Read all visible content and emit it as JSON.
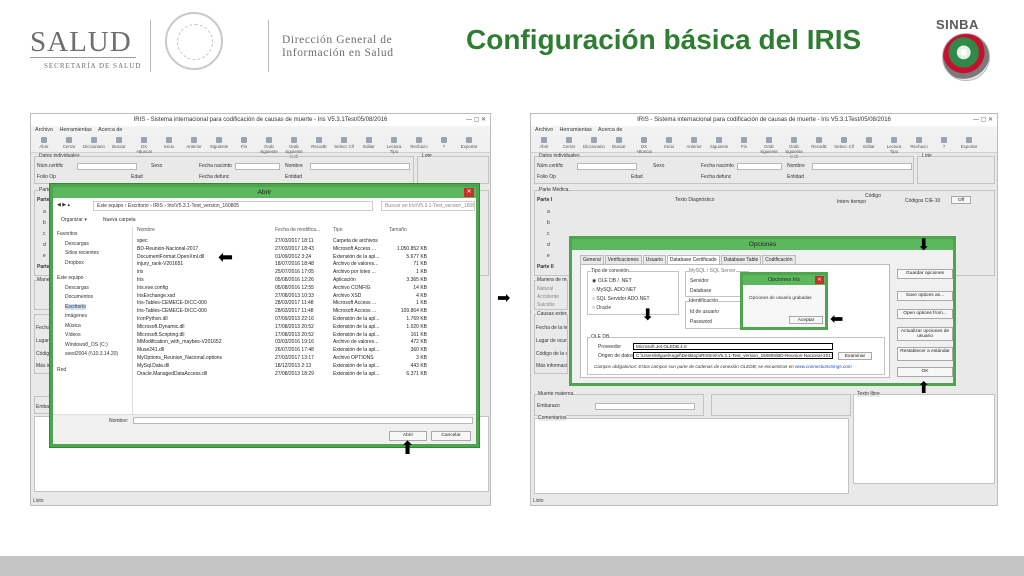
{
  "header": {
    "salud": "SALUD",
    "salud_sub": "SECRETARÍA DE SALUD",
    "dgis_line1": "Dirección General de",
    "dgis_line2": "Información en Salud",
    "title": "Configuración básica del IRIS",
    "sinba": "SINBA"
  },
  "iris": {
    "title": "IRIS - Sistema internacional para codificación de causas de muerte - Iris V5.3.1Test/05/08/2016",
    "menu": [
      "Archivo",
      "Herramientas",
      "Acerca de"
    ],
    "toolbar": [
      "Abrir",
      "Cerrar",
      "Diccionario",
      "Buscar",
      "DX +Buscar",
      "Inicio",
      "Anterior",
      "Siguiente",
      "Fin",
      "Grab siguiente",
      "Grab siguiente rech",
      "RecodE",
      "Selecc Cll",
      "Editar",
      "Lectura Tipo",
      "Rechazo",
      "?",
      "Exportar"
    ],
    "labels": {
      "datos": "Datos individuales",
      "num_certific": "Núm.certific",
      "sexo": "Sexo",
      "fecha_nacimto": "Fecha nacimto",
      "nombre": "Nombre",
      "folio_op": "Folio Op",
      "edad": "Edad",
      "fecha_defunc": "Fecha defunc",
      "entidad": "Entidad",
      "lote": "Lote",
      "parte_medica": "Parte Médica",
      "parte_i": "Parte I",
      "parte_ii": "Parte II",
      "texto_diag": "Texto Diagnóstico",
      "intervalo": "Interv tiempo",
      "codigo": "Código",
      "codigos_cie": "Códigos CIE-10",
      "off": "Off",
      "manera_muerte": "Manera de muerte",
      "natural": "Natural",
      "accidente": "Accidente",
      "suicidio": "Suicidio",
      "causas_externas": "Causas externas",
      "fecha_lesion": "Fecha de la lesión",
      "lugar_ocurrencia": "Lugar de ocurrencia",
      "codigo_ext": "Código de la causa",
      "mas_info": "Más información",
      "muerte_materna": "Muerte materna",
      "embarazo": "Embarazo",
      "texto_libre": "Texto libre",
      "comentarios": "Comentarios",
      "rows": [
        "a",
        "b",
        "c",
        "d",
        "e"
      ],
      "status": "Listo"
    }
  },
  "open_dialog": {
    "title": "Abrir",
    "path": [
      "Este equipo",
      "Escritorio",
      "IRIS",
      "Iris\\V5.3.1-Test_version_160805"
    ],
    "search_placeholder": "Buscar en Iris\\V5.3.1-Test_version_160805",
    "organize": "Organizar ▾",
    "new_folder": "Nueva carpeta",
    "nav": [
      "Favoritos",
      "Descargas",
      "Sitios recientes",
      "Dropbox",
      "Este equipo",
      "Descargas",
      "Documentos",
      "Escritorio",
      "Imágenes",
      "Música",
      "Vídeos",
      "Windows8_OS (C:)",
      "seed2004 (\\\\10.3.14.20)",
      "Red"
    ],
    "columns": [
      "Nombre",
      "Fecha de modifica...",
      "Tipo",
      "Tamaño"
    ],
    "files": [
      [
        "spec",
        "27/03/2017 18:11",
        "Carpeta de archivos",
        ""
      ],
      [
        "BD-Reunion-Nacional-2017",
        "27/03/2017 18:43",
        "Microsoft Access ...",
        "1.050.852 KB"
      ],
      [
        "DocumentFormat.OpenXml.dll",
        "01/09/2012 3:24",
        "Extensión de la apl...",
        "5.677 KB"
      ],
      [
        "injury_rank-V201651",
        "18/07/2016 18:48",
        "Archivo de valores...",
        "71 KB"
      ],
      [
        "iris",
        "25/07/2016 17:05",
        "Archivo por lotes ...",
        "1 KB"
      ],
      [
        "Iris",
        "05/08/2016 12:26",
        "Aplicación",
        "3.365 KB"
      ],
      [
        "Iris.exe.config",
        "05/08/2016 12:55",
        "Archivo CONFIG",
        "14 KB"
      ],
      [
        "IrisExchange.xsd",
        "27/08/2013 10:33",
        "Archivo XSD",
        "4 KB"
      ],
      [
        "Iris-Tables-CEMECE-DICC-000",
        "28/03/2017 11:48",
        "Microsoft Access ...",
        "1 KB"
      ],
      [
        "Iris-Tables-CEMECE-DICC-000",
        "28/03/2017 11:48",
        "Microsoft Access ...",
        "109.864 KB"
      ],
      [
        "IronPython.dll",
        "07/09/2013 22:16",
        "Extensión de la apl...",
        "1.769 KB"
      ],
      [
        "Microsoft.Dynamic.dll",
        "17/08/2013 20:52",
        "Extensión de la apl...",
        "1.020 KB"
      ],
      [
        "Microsoft.Scripting.dll",
        "17/08/2013 20:52",
        "Extensión de la apl...",
        "161 KB"
      ],
      [
        "MModification_with_maybes-V201652",
        "03/03/2016 19:16",
        "Archivo de valores...",
        "472 KB"
      ],
      [
        "Muse241.dll",
        "26/07/2016 17:48",
        "Extensión de la apl...",
        "360 KB"
      ],
      [
        "MyOptions_Reunion_Nacional.options",
        "27/03/2017 13:17",
        "Archivo OPTIONS",
        "3 KB"
      ],
      [
        "MySql.Data.dll",
        "18/12/2013 2:13",
        "Extensión de la apl...",
        "443 KB"
      ],
      [
        "Oracle.ManagedDataAccess.dll",
        "27/08/2013 18:29",
        "Extensión de la apl...",
        "6.371 KB"
      ]
    ],
    "name_label": "Nombre:",
    "open_btn": "Abrir",
    "cancel_btn": "Cancelar"
  },
  "options_dialog": {
    "title": "Opciones",
    "tabs": [
      "General",
      "Verificaciones",
      "Usuario",
      "Database Certificado",
      "Database Table",
      "Codificación"
    ],
    "tipo_conexion": "Tipo de conexión",
    "radios": [
      "OLE DB / .NET",
      "MySQL ADO.NET",
      "SQL Servidor ADO.NET",
      "Oracle"
    ],
    "mysql": "MySQL / SQL Server",
    "servidor": "Servidor",
    "database": "Database",
    "identificacion": "Identificación",
    "id_usuario": "Id de usuario",
    "password": "Password",
    "oledb": "OLE DB",
    "proveedor": "Proveedor",
    "proveedor_val": "Microsoft.Jet.OLEDB.4.0",
    "origen": "Origen de datos",
    "origen_val": "C:\\Users\\MiguelAngel\\Desktop\\IRIS\\Iris\\V5.3.1-Test_version_160805\\BD-Reunion-Nacional-2017",
    "examinar": "Examinar",
    "required": "Campos obligatorios: Estos campos son parte de cadenas de conexión OLEDB; se encuentran en",
    "link": "www.connectionstrings.com",
    "side_buttons": [
      "Guardar opciones",
      "Save options as...",
      "Open options from...",
      "Actualizar opciones de usuario",
      "Restablecer a estándar",
      "OK"
    ]
  },
  "small_dialog": {
    "title": "Opciones Iris",
    "message": "Opciones de usuario grabadas",
    "ok": "Aceptar"
  }
}
